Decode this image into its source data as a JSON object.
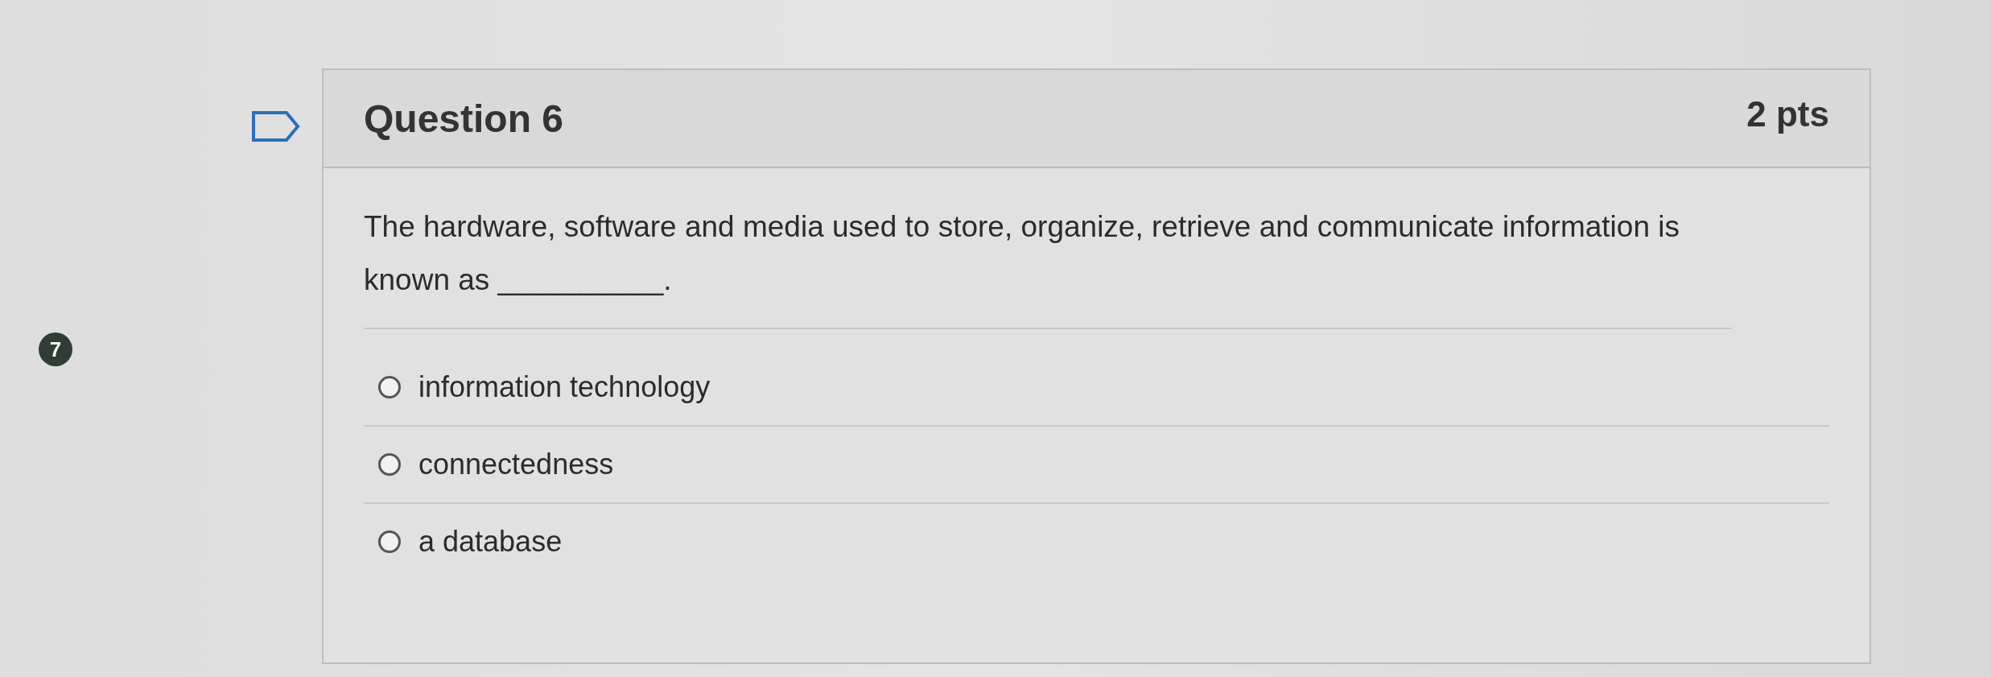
{
  "badge": "7",
  "question": {
    "title": "Question 6",
    "points": "2 pts",
    "prompt": "The hardware, software and media used to store, organize, retrieve and communicate information is known as __________.",
    "options": [
      {
        "label": "information technology",
        "selected": false
      },
      {
        "label": "connectedness",
        "selected": false
      },
      {
        "label": "a database",
        "selected": false
      }
    ]
  }
}
